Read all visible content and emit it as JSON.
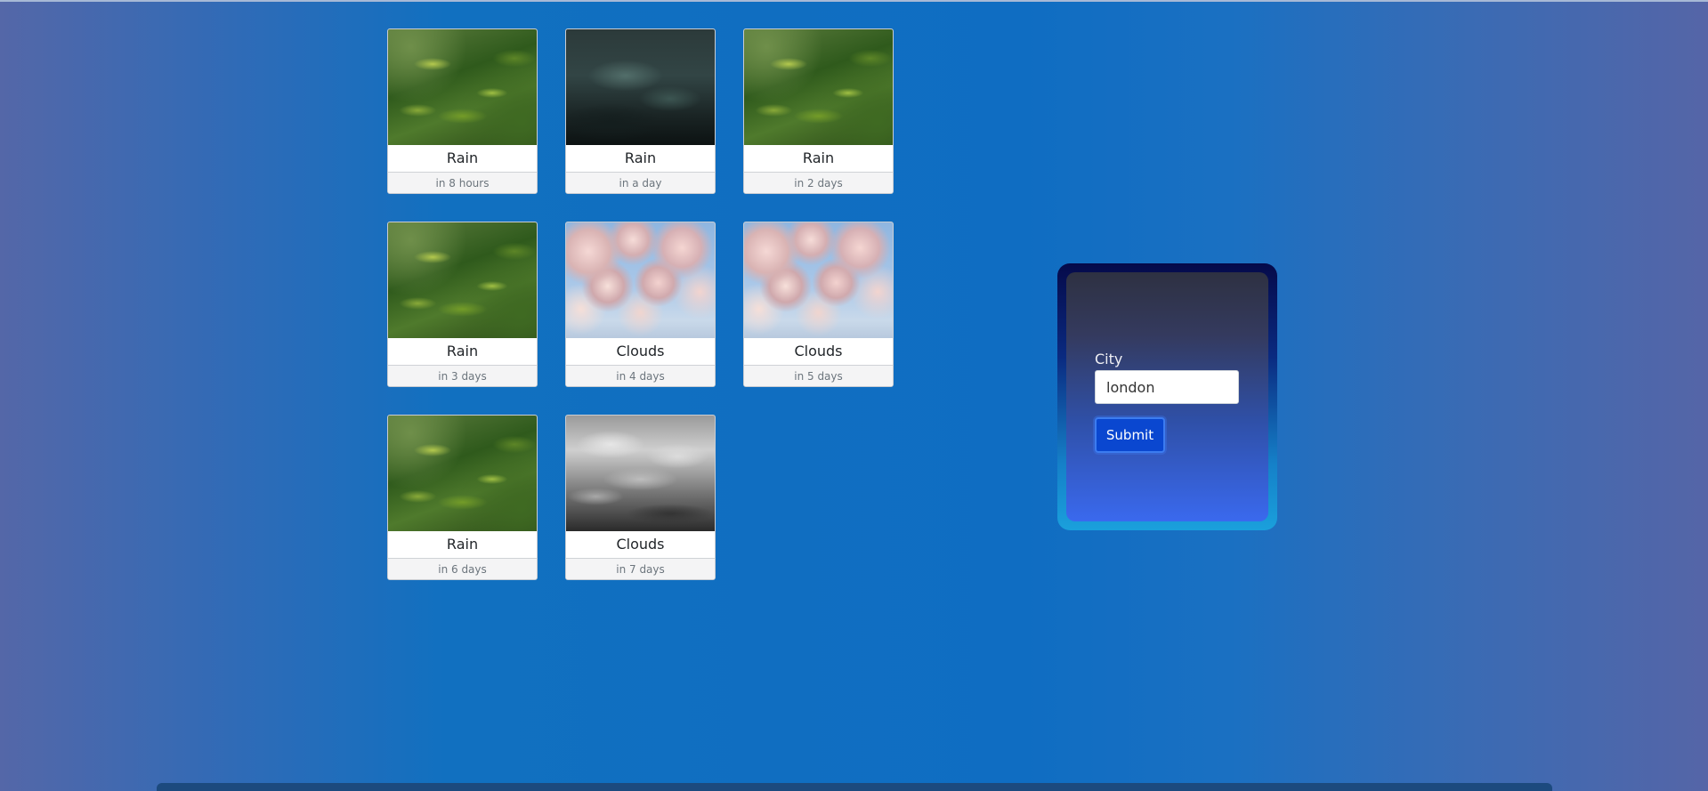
{
  "forecast": {
    "cards": [
      {
        "condition": "Rain",
        "time": "in 8 hours",
        "image": "green-foliage-photo"
      },
      {
        "condition": "Rain",
        "time": "in a day",
        "image": "dark-storm-clouds-photo"
      },
      {
        "condition": "Rain",
        "time": "in 2 days",
        "image": "green-foliage-photo"
      },
      {
        "condition": "Rain",
        "time": "in 3 days",
        "image": "green-foliage-photo"
      },
      {
        "condition": "Clouds",
        "time": "in 4 days",
        "image": "pink-cumulus-clouds-photo"
      },
      {
        "condition": "Clouds",
        "time": "in 5 days",
        "image": "pink-cumulus-clouds-photo"
      },
      {
        "condition": "Rain",
        "time": "in 6 days",
        "image": "green-foliage-photo"
      },
      {
        "condition": "Clouds",
        "time": "in 7 days",
        "image": "gray-clouds-photo"
      }
    ]
  },
  "form": {
    "city_label": "City",
    "city_value": "london",
    "submit_label": "Submit"
  }
}
